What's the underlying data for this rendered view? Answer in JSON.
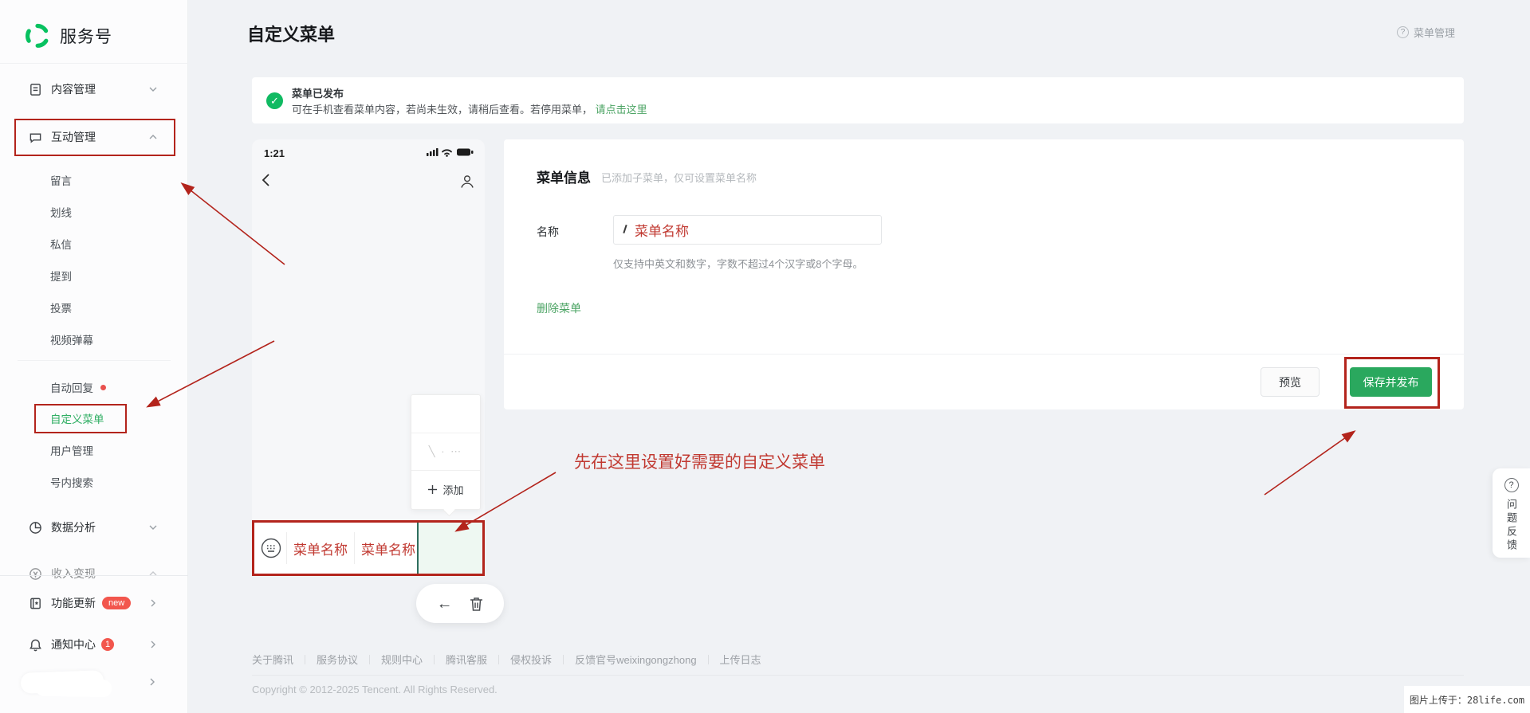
{
  "brand": {
    "name": "服务号"
  },
  "sidebar": {
    "content_mgmt": "内容管理",
    "interact_mgmt": "互动管理",
    "interact_items": [
      "留言",
      "划线",
      "私信",
      "提到",
      "投票",
      "视频弹幕"
    ],
    "auto_reply": "自动回复",
    "custom_menu": "自定义菜单",
    "user_mgmt": "用户管理",
    "account_search": "号内搜索",
    "data_analysis": "数据分析",
    "monetization": "收入变现",
    "feature_update": "功能更新",
    "feature_update_badge": "new",
    "notification_center": "通知中心",
    "notification_badge": "1"
  },
  "header": {
    "title": "自定义菜单",
    "help": "菜单管理"
  },
  "banner": {
    "title": "菜单已发布",
    "body": "可在手机查看菜单内容，若尚未生效，请稍后查看。若停用菜单，",
    "link": "请点击这里"
  },
  "phone": {
    "time": "1:21",
    "menu1": "菜单名称",
    "menu2": "菜单名称",
    "popup_scribble": "╲ · ⋯",
    "popup_add": "添加"
  },
  "panel": {
    "title": "菜单信息",
    "subtitle": "已添加子菜单，仅可设置菜单名称",
    "name_label": "名称",
    "name_value": "菜单名称",
    "hint": "仅支持中英文和数字，字数不超过4个汉字或8个字母。",
    "delete": "删除菜单",
    "preview": "预览",
    "save": "保存并发布"
  },
  "annotation": {
    "tip": "先在这里设置好需要的自定义菜单"
  },
  "footer": {
    "links": [
      "关于腾讯",
      "服务协议",
      "规则中心",
      "腾讯客服",
      "侵权投诉",
      "反馈官号weixingongzhong",
      "上传日志"
    ],
    "copyright": "Copyright © 2012-2025 Tencent. All Rights Reserved."
  },
  "feedback": {
    "label": "问题反馈"
  },
  "watermark": {
    "text": "图片上传于：28life.com"
  },
  "colors": {
    "brand_green": "#07c160",
    "button_green": "#2aa85e",
    "annotation_red": "#b3241c",
    "badge_red": "#f2564d"
  }
}
